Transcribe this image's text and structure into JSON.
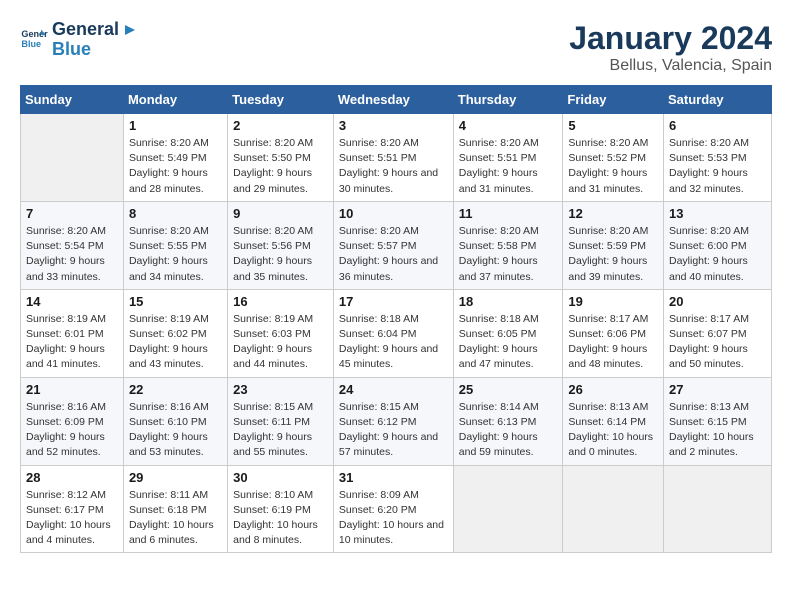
{
  "logo": {
    "line1": "General",
    "line2": "Blue"
  },
  "title": "January 2024",
  "subtitle": "Bellus, Valencia, Spain",
  "days_of_week": [
    "Sunday",
    "Monday",
    "Tuesday",
    "Wednesday",
    "Thursday",
    "Friday",
    "Saturday"
  ],
  "weeks": [
    [
      {
        "num": "",
        "empty": true
      },
      {
        "num": "1",
        "sunrise": "Sunrise: 8:20 AM",
        "sunset": "Sunset: 5:49 PM",
        "daylight": "Daylight: 9 hours and 28 minutes."
      },
      {
        "num": "2",
        "sunrise": "Sunrise: 8:20 AM",
        "sunset": "Sunset: 5:50 PM",
        "daylight": "Daylight: 9 hours and 29 minutes."
      },
      {
        "num": "3",
        "sunrise": "Sunrise: 8:20 AM",
        "sunset": "Sunset: 5:51 PM",
        "daylight": "Daylight: 9 hours and 30 minutes."
      },
      {
        "num": "4",
        "sunrise": "Sunrise: 8:20 AM",
        "sunset": "Sunset: 5:51 PM",
        "daylight": "Daylight: 9 hours and 31 minutes."
      },
      {
        "num": "5",
        "sunrise": "Sunrise: 8:20 AM",
        "sunset": "Sunset: 5:52 PM",
        "daylight": "Daylight: 9 hours and 31 minutes."
      },
      {
        "num": "6",
        "sunrise": "Sunrise: 8:20 AM",
        "sunset": "Sunset: 5:53 PM",
        "daylight": "Daylight: 9 hours and 32 minutes."
      }
    ],
    [
      {
        "num": "7",
        "sunrise": "Sunrise: 8:20 AM",
        "sunset": "Sunset: 5:54 PM",
        "daylight": "Daylight: 9 hours and 33 minutes."
      },
      {
        "num": "8",
        "sunrise": "Sunrise: 8:20 AM",
        "sunset": "Sunset: 5:55 PM",
        "daylight": "Daylight: 9 hours and 34 minutes."
      },
      {
        "num": "9",
        "sunrise": "Sunrise: 8:20 AM",
        "sunset": "Sunset: 5:56 PM",
        "daylight": "Daylight: 9 hours and 35 minutes."
      },
      {
        "num": "10",
        "sunrise": "Sunrise: 8:20 AM",
        "sunset": "Sunset: 5:57 PM",
        "daylight": "Daylight: 9 hours and 36 minutes."
      },
      {
        "num": "11",
        "sunrise": "Sunrise: 8:20 AM",
        "sunset": "Sunset: 5:58 PM",
        "daylight": "Daylight: 9 hours and 37 minutes."
      },
      {
        "num": "12",
        "sunrise": "Sunrise: 8:20 AM",
        "sunset": "Sunset: 5:59 PM",
        "daylight": "Daylight: 9 hours and 39 minutes."
      },
      {
        "num": "13",
        "sunrise": "Sunrise: 8:20 AM",
        "sunset": "Sunset: 6:00 PM",
        "daylight": "Daylight: 9 hours and 40 minutes."
      }
    ],
    [
      {
        "num": "14",
        "sunrise": "Sunrise: 8:19 AM",
        "sunset": "Sunset: 6:01 PM",
        "daylight": "Daylight: 9 hours and 41 minutes."
      },
      {
        "num": "15",
        "sunrise": "Sunrise: 8:19 AM",
        "sunset": "Sunset: 6:02 PM",
        "daylight": "Daylight: 9 hours and 43 minutes."
      },
      {
        "num": "16",
        "sunrise": "Sunrise: 8:19 AM",
        "sunset": "Sunset: 6:03 PM",
        "daylight": "Daylight: 9 hours and 44 minutes."
      },
      {
        "num": "17",
        "sunrise": "Sunrise: 8:18 AM",
        "sunset": "Sunset: 6:04 PM",
        "daylight": "Daylight: 9 hours and 45 minutes."
      },
      {
        "num": "18",
        "sunrise": "Sunrise: 8:18 AM",
        "sunset": "Sunset: 6:05 PM",
        "daylight": "Daylight: 9 hours and 47 minutes."
      },
      {
        "num": "19",
        "sunrise": "Sunrise: 8:17 AM",
        "sunset": "Sunset: 6:06 PM",
        "daylight": "Daylight: 9 hours and 48 minutes."
      },
      {
        "num": "20",
        "sunrise": "Sunrise: 8:17 AM",
        "sunset": "Sunset: 6:07 PM",
        "daylight": "Daylight: 9 hours and 50 minutes."
      }
    ],
    [
      {
        "num": "21",
        "sunrise": "Sunrise: 8:16 AM",
        "sunset": "Sunset: 6:09 PM",
        "daylight": "Daylight: 9 hours and 52 minutes."
      },
      {
        "num": "22",
        "sunrise": "Sunrise: 8:16 AM",
        "sunset": "Sunset: 6:10 PM",
        "daylight": "Daylight: 9 hours and 53 minutes."
      },
      {
        "num": "23",
        "sunrise": "Sunrise: 8:15 AM",
        "sunset": "Sunset: 6:11 PM",
        "daylight": "Daylight: 9 hours and 55 minutes."
      },
      {
        "num": "24",
        "sunrise": "Sunrise: 8:15 AM",
        "sunset": "Sunset: 6:12 PM",
        "daylight": "Daylight: 9 hours and 57 minutes."
      },
      {
        "num": "25",
        "sunrise": "Sunrise: 8:14 AM",
        "sunset": "Sunset: 6:13 PM",
        "daylight": "Daylight: 9 hours and 59 minutes."
      },
      {
        "num": "26",
        "sunrise": "Sunrise: 8:13 AM",
        "sunset": "Sunset: 6:14 PM",
        "daylight": "Daylight: 10 hours and 0 minutes."
      },
      {
        "num": "27",
        "sunrise": "Sunrise: 8:13 AM",
        "sunset": "Sunset: 6:15 PM",
        "daylight": "Daylight: 10 hours and 2 minutes."
      }
    ],
    [
      {
        "num": "28",
        "sunrise": "Sunrise: 8:12 AM",
        "sunset": "Sunset: 6:17 PM",
        "daylight": "Daylight: 10 hours and 4 minutes."
      },
      {
        "num": "29",
        "sunrise": "Sunrise: 8:11 AM",
        "sunset": "Sunset: 6:18 PM",
        "daylight": "Daylight: 10 hours and 6 minutes."
      },
      {
        "num": "30",
        "sunrise": "Sunrise: 8:10 AM",
        "sunset": "Sunset: 6:19 PM",
        "daylight": "Daylight: 10 hours and 8 minutes."
      },
      {
        "num": "31",
        "sunrise": "Sunrise: 8:09 AM",
        "sunset": "Sunset: 6:20 PM",
        "daylight": "Daylight: 10 hours and 10 minutes."
      },
      {
        "num": "",
        "empty": true
      },
      {
        "num": "",
        "empty": true
      },
      {
        "num": "",
        "empty": true
      }
    ]
  ]
}
